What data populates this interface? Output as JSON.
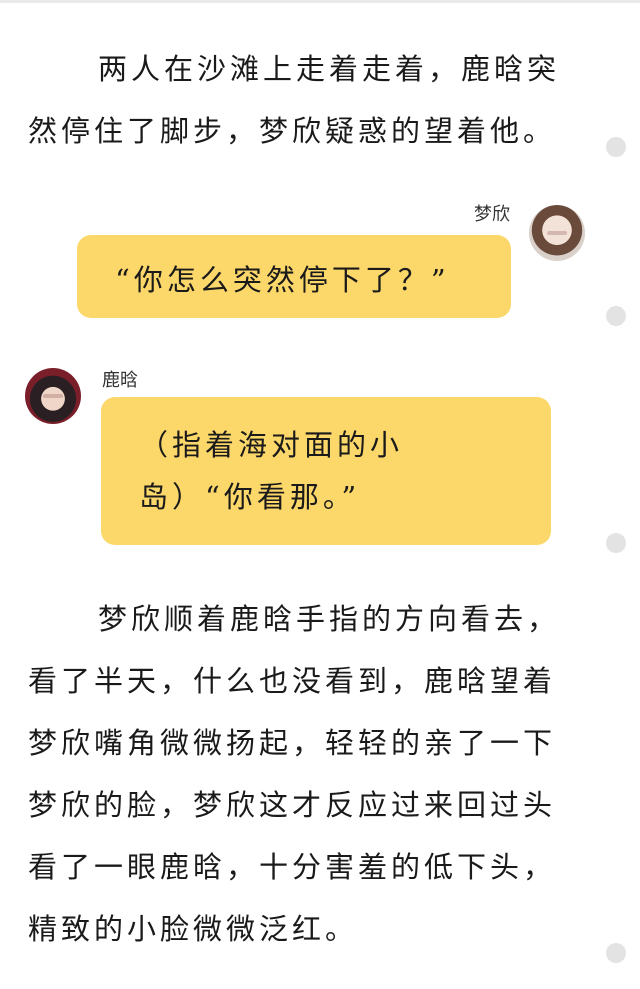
{
  "paragraphs": [
    "两人在沙滩上走着走着，鹿晗突然停住了脚步，梦欣疑惑的望着他。",
    "梦欣顺着鹿晗手指的方向看去，看了半天，什么也没看到，鹿晗望着梦欣嘴角微微扬起，轻轻的亲了一下梦欣的脸，梦欣这才反应过来回过头看了一眼鹿晗，十分害羞的低下头，精致的小脸微微泛红。"
  ],
  "messages": [
    {
      "speaker": "梦欣",
      "side": "right",
      "avatar": "avatar-girl-long-hair",
      "text": "“你怎么突然停下了？”"
    },
    {
      "speaker": "鹿晗",
      "side": "left",
      "avatar": "avatar-boy-red-jacket",
      "lines": [
        "（指着海对面的小",
        "岛）“你看那。”"
      ]
    }
  ],
  "colors": {
    "bubble": "#fcd76a",
    "side_dots": "#e3e3e3",
    "text": "#1a1a1a"
  }
}
